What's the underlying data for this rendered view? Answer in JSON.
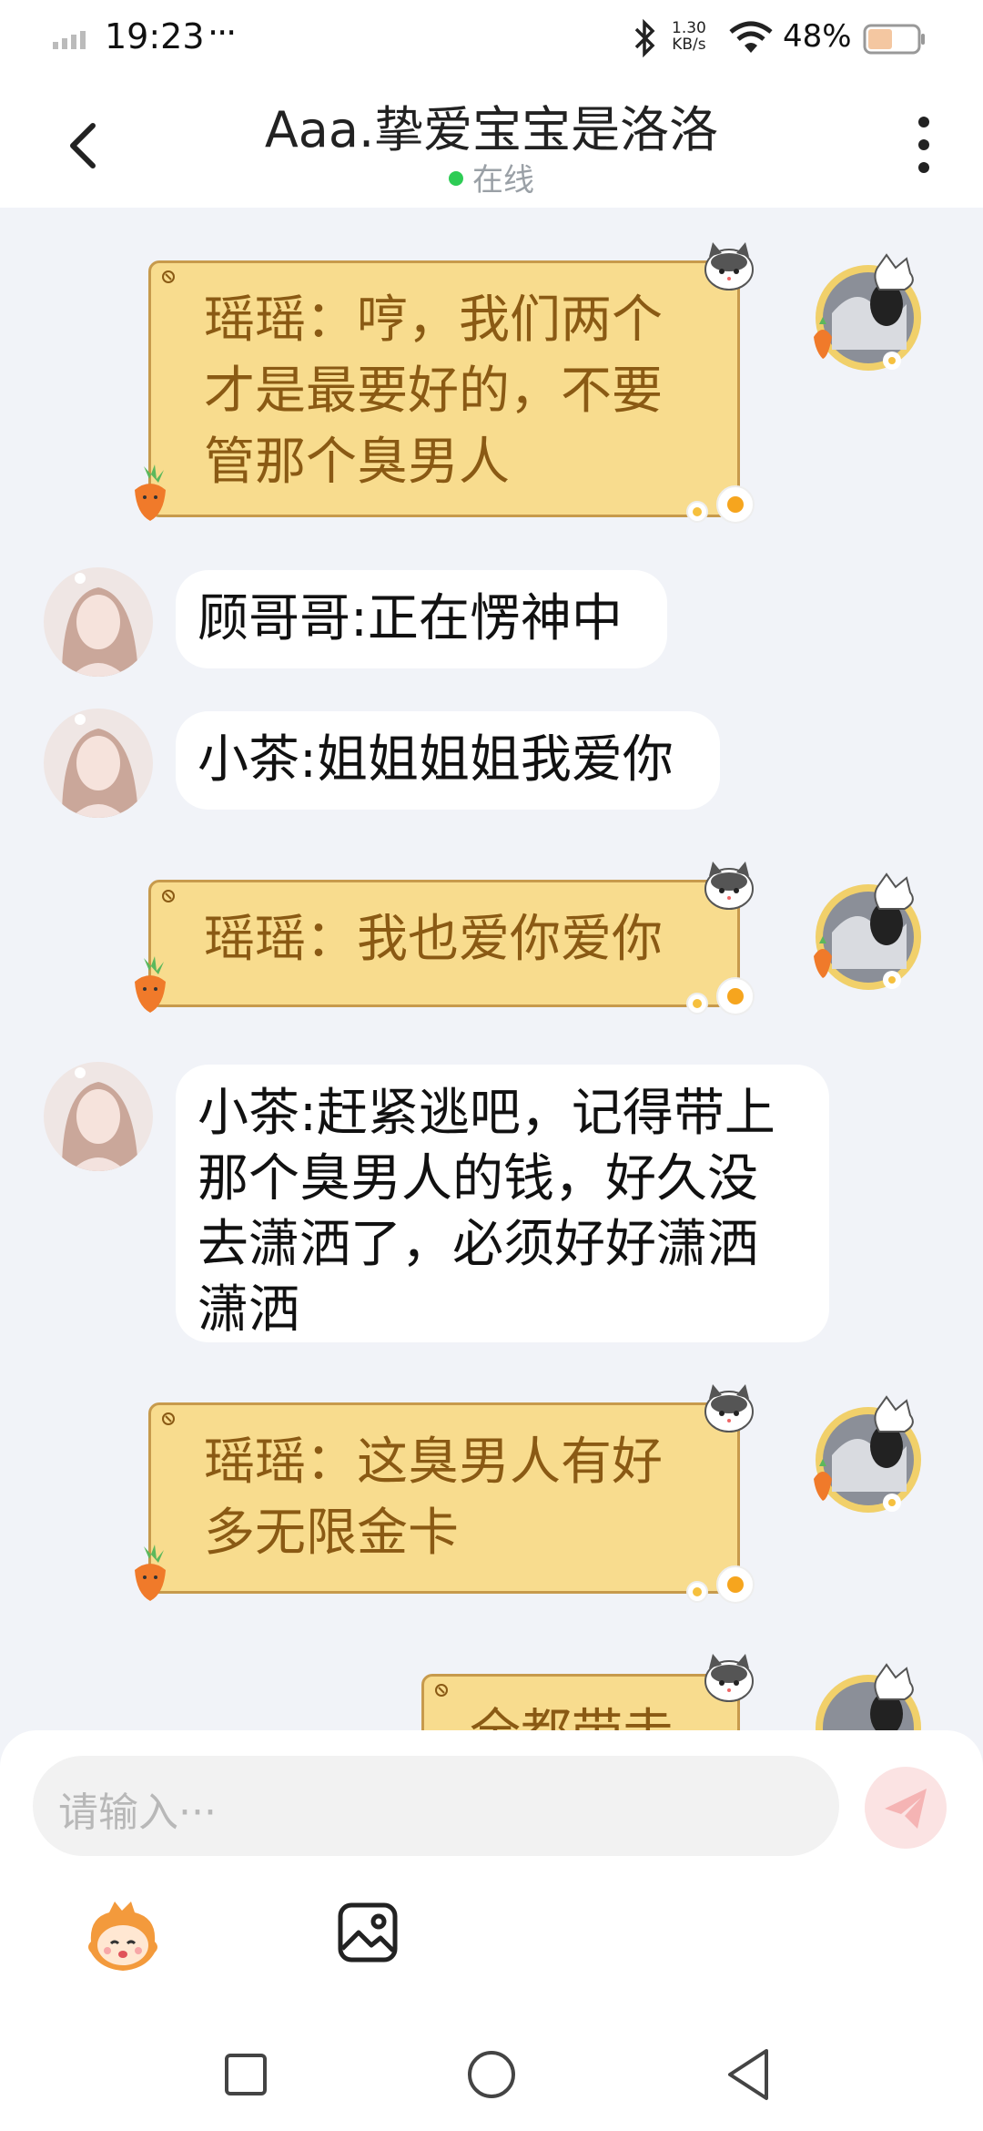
{
  "status_bar": {
    "time": "19:23",
    "dots": "···",
    "net_speed_value": "1.30",
    "net_speed_unit": "KB/s",
    "battery": "48%"
  },
  "header": {
    "title": "Aaa.挚爱宝宝是洛洛",
    "status": "在线"
  },
  "messages": [
    {
      "side": "me",
      "text": "瑶瑶：哼，我们两个才是最要好的，不要管那个臭男人"
    },
    {
      "side": "other",
      "text": "顾哥哥:正在愣神中"
    },
    {
      "side": "other",
      "text": "小茶:姐姐姐姐我爱你"
    },
    {
      "side": "me",
      "text": "瑶瑶：我也爱你爱你"
    },
    {
      "side": "other",
      "text": "小茶:赶紧逃吧，记得带上那个臭男人的钱，好久没去潇洒了，必须好好潇洒潇洒"
    },
    {
      "side": "me",
      "text": "瑶瑶：这臭男人有好多无限金卡"
    },
    {
      "side": "me",
      "text": "全都带走"
    }
  ],
  "input": {
    "placeholder": "请输入···"
  },
  "icons": {
    "back": "chevron-left-icon",
    "more": "more-vertical-icon",
    "send": "send-icon",
    "emoji": "emoji-mascot-icon",
    "image": "image-icon"
  },
  "colors": {
    "my_bubble": "#F8DC8E",
    "my_bubble_border": "#C79A4C",
    "my_text": "#8A5A14",
    "online": "#2ecc55",
    "background": "#F1F3F8"
  }
}
